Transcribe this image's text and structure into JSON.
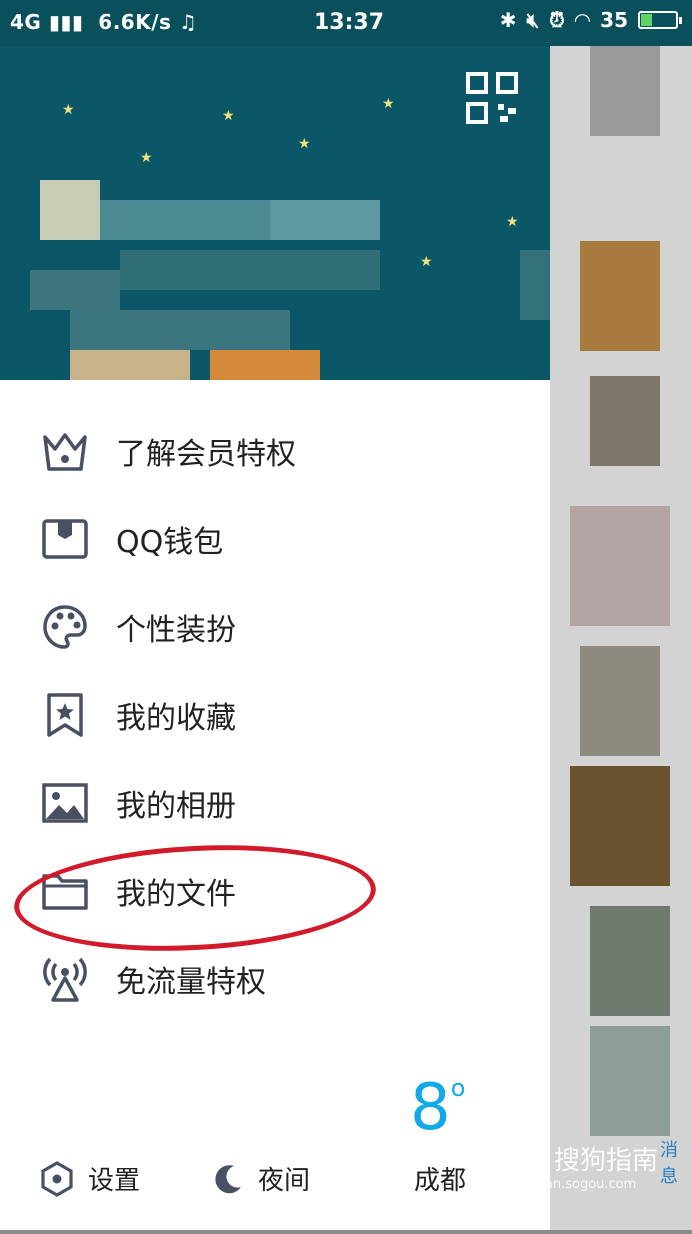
{
  "status_bar": {
    "network": "4G",
    "speed": "6.6K/s ♫",
    "time": "13:37",
    "battery": "35"
  },
  "menu": [
    {
      "label": "了解会员特权",
      "icon": "crown-icon"
    },
    {
      "label": "QQ钱包",
      "icon": "wallet-icon"
    },
    {
      "label": "个性装扮",
      "icon": "palette-icon"
    },
    {
      "label": "我的收藏",
      "icon": "bookmark-star-icon"
    },
    {
      "label": "我的相册",
      "icon": "image-icon"
    },
    {
      "label": "我的文件",
      "icon": "folder-icon"
    },
    {
      "label": "免流量特权",
      "icon": "broadcast-icon"
    }
  ],
  "bottom": {
    "settings": "设置",
    "night": "夜间",
    "city": "成都",
    "temperature": "8",
    "degree": "o"
  },
  "watermark": {
    "brand": "搜狗指南",
    "url": "zhinan.sogou.com"
  },
  "right_panel": {
    "tab_label": "消息"
  },
  "colors": {
    "hero_bg": "#0b5767",
    "accent_temp": "#12a9e6",
    "annotation_circle": "#d11a2a"
  }
}
